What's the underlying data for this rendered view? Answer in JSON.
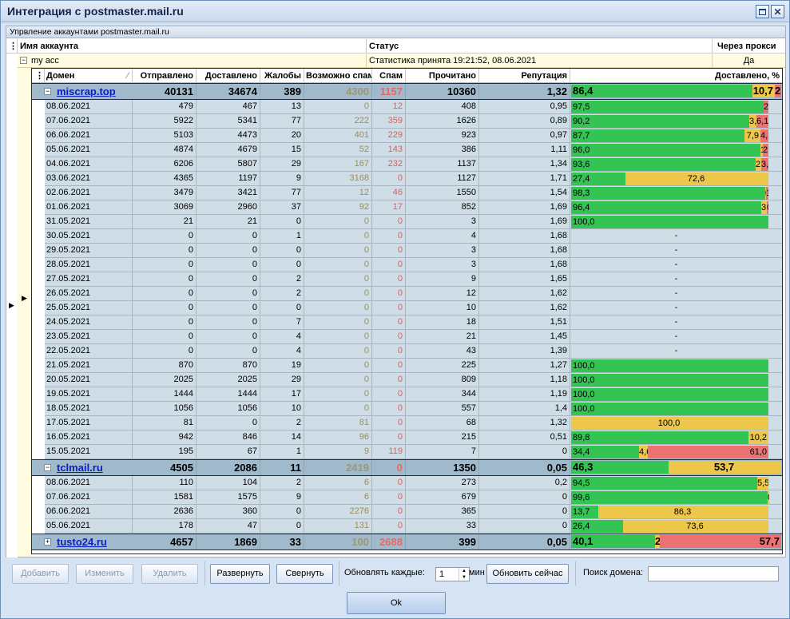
{
  "window": {
    "title": "Интеграция с postmaster.mail.ru"
  },
  "colors": {
    "green": "#33c454",
    "yellow": "#ecc74a",
    "red": "#ec7272",
    "link": "#0a1fbf",
    "group_bg": "#a1bacb",
    "row_bg": "#cfdde6"
  },
  "group_caption": "Упрвление аккаунтами postmaster.mail.ru",
  "accounts_header": {
    "name": "Имя аккаунта",
    "status": "Статус",
    "proxy": "Через прокси"
  },
  "account": {
    "name": "my acc",
    "status": "Статистика принята 19:21:52, 08.06.2021",
    "proxy": "Да"
  },
  "columns": {
    "domain": "Домен",
    "sent": "Отправлено",
    "delivered": "Доставлено",
    "complaints": "Жалобы",
    "possible_spam": "Возможно спам",
    "spam": "Спам",
    "read": "Прочитано",
    "reputation": "Репутация",
    "delivered_pct": "Доставлено, %"
  },
  "domains": [
    {
      "name": "miscrap.top",
      "expand": "−",
      "sent": "40131",
      "delivered": "34674",
      "complaints": "389",
      "possible_spam": "4300",
      "spam": "1157",
      "read": "10360",
      "reputation": "1,32",
      "bar": [
        {
          "v": 86.4,
          "t": "86,4",
          "c": "g"
        },
        {
          "v": 10.7,
          "t": "10,7",
          "c": "y"
        },
        {
          "v": 2.9,
          "t": "2,9",
          "c": "r"
        }
      ],
      "rows": [
        {
          "date": "08.06.2021",
          "sent": "479",
          "delivered": "467",
          "complaints": "13",
          "possible_spam": "0",
          "spam": "12",
          "read": "408",
          "reputation": "0,95",
          "bar": [
            {
              "v": 97.5,
              "t": "97,5",
              "c": "g"
            },
            {
              "v": 0,
              "t": "",
              "c": "y"
            },
            {
              "v": 2.5,
              "t": "2,5",
              "c": "r"
            }
          ]
        },
        {
          "date": "07.06.2021",
          "sent": "5922",
          "delivered": "5341",
          "complaints": "77",
          "possible_spam": "222",
          "spam": "359",
          "read": "1626",
          "reputation": "0,89",
          "bar": [
            {
              "v": 90.2,
              "t": "90,2",
              "c": "g"
            },
            {
              "v": 3.7,
              "t": "3,7",
              "c": "y"
            },
            {
              "v": 6.1,
              "t": "6,1",
              "c": "r"
            }
          ]
        },
        {
          "date": "06.06.2021",
          "sent": "5103",
          "delivered": "4473",
          "complaints": "20",
          "possible_spam": "401",
          "spam": "229",
          "read": "923",
          "reputation": "0,97",
          "bar": [
            {
              "v": 87.7,
              "t": "87,7",
              "c": "g"
            },
            {
              "v": 7.9,
              "t": "7,9",
              "c": "y"
            },
            {
              "v": 4.5,
              "t": "4,5",
              "c": "r"
            }
          ]
        },
        {
          "date": "05.06.2021",
          "sent": "4874",
          "delivered": "4679",
          "complaints": "15",
          "possible_spam": "52",
          "spam": "143",
          "read": "386",
          "reputation": "1,11",
          "bar": [
            {
              "v": 96.0,
              "t": "96,0",
              "c": "g"
            },
            {
              "v": 1.1,
              "t": "1,1",
              "c": "y"
            },
            {
              "v": 2.9,
              "t": "2,9",
              "c": "r"
            }
          ]
        },
        {
          "date": "04.06.2021",
          "sent": "6206",
          "delivered": "5807",
          "complaints": "29",
          "possible_spam": "167",
          "spam": "232",
          "read": "1137",
          "reputation": "1,34",
          "bar": [
            {
              "v": 93.6,
              "t": "93,6",
              "c": "g"
            },
            {
              "v": 2.7,
              "t": "2,7",
              "c": "y"
            },
            {
              "v": 3.7,
              "t": "3,7",
              "c": "r"
            }
          ]
        },
        {
          "date": "03.06.2021",
          "sent": "4365",
          "delivered": "1197",
          "complaints": "9",
          "possible_spam": "3168",
          "spam": "0",
          "read": "1127",
          "reputation": "1,71",
          "bar": [
            {
              "v": 27.4,
              "t": "27,4",
              "c": "g"
            },
            {
              "v": 72.6,
              "t": "72,6",
              "c": "y"
            },
            {
              "v": 0,
              "t": "",
              "c": "r"
            }
          ]
        },
        {
          "date": "02.06.2021",
          "sent": "3479",
          "delivered": "3421",
          "complaints": "77",
          "possible_spam": "12",
          "spam": "46",
          "read": "1550",
          "reputation": "1,54",
          "bar": [
            {
              "v": 98.3,
              "t": "98,3",
              "c": "g"
            },
            {
              "v": 0.3,
              "t": "0,3",
              "c": "y"
            },
            {
              "v": 1.3,
              "t": "1,3",
              "c": "r"
            }
          ]
        },
        {
          "date": "01.06.2021",
          "sent": "3069",
          "delivered": "2960",
          "complaints": "37",
          "possible_spam": "92",
          "spam": "17",
          "read": "852",
          "reputation": "1,69",
          "bar": [
            {
              "v": 96.4,
              "t": "96,4",
              "c": "g"
            },
            {
              "v": 3.0,
              "t": "3,0",
              "c": "y"
            },
            {
              "v": 0.6,
              "t": "0,6",
              "c": "r"
            }
          ]
        },
        {
          "date": "31.05.2021",
          "sent": "21",
          "delivered": "21",
          "complaints": "0",
          "possible_spam": "0",
          "spam": "0",
          "read": "3",
          "reputation": "1,69",
          "bar": [
            {
              "v": 100,
              "t": "100,0",
              "c": "g"
            }
          ]
        },
        {
          "date": "30.05.2021",
          "sent": "0",
          "delivered": "0",
          "complaints": "1",
          "possible_spam": "0",
          "spam": "0",
          "read": "4",
          "reputation": "1,68",
          "bar": "-"
        },
        {
          "date": "29.05.2021",
          "sent": "0",
          "delivered": "0",
          "complaints": "0",
          "possible_spam": "0",
          "spam": "0",
          "read": "3",
          "reputation": "1,68",
          "bar": "-"
        },
        {
          "date": "28.05.2021",
          "sent": "0",
          "delivered": "0",
          "complaints": "0",
          "possible_spam": "0",
          "spam": "0",
          "read": "3",
          "reputation": "1,68",
          "bar": "-"
        },
        {
          "date": "27.05.2021",
          "sent": "0",
          "delivered": "0",
          "complaints": "2",
          "possible_spam": "0",
          "spam": "0",
          "read": "9",
          "reputation": "1,65",
          "bar": "-"
        },
        {
          "date": "26.05.2021",
          "sent": "0",
          "delivered": "0",
          "complaints": "2",
          "possible_spam": "0",
          "spam": "0",
          "read": "12",
          "reputation": "1,62",
          "bar": "-"
        },
        {
          "date": "25.05.2021",
          "sent": "0",
          "delivered": "0",
          "complaints": "0",
          "possible_spam": "0",
          "spam": "0",
          "read": "10",
          "reputation": "1,62",
          "bar": "-"
        },
        {
          "date": "24.05.2021",
          "sent": "0",
          "delivered": "0",
          "complaints": "7",
          "possible_spam": "0",
          "spam": "0",
          "read": "18",
          "reputation": "1,51",
          "bar": "-"
        },
        {
          "date": "23.05.2021",
          "sent": "0",
          "delivered": "0",
          "complaints": "4",
          "possible_spam": "0",
          "spam": "0",
          "read": "21",
          "reputation": "1,45",
          "bar": "-"
        },
        {
          "date": "22.05.2021",
          "sent": "0",
          "delivered": "0",
          "complaints": "4",
          "possible_spam": "0",
          "spam": "0",
          "read": "43",
          "reputation": "1,39",
          "bar": "-"
        },
        {
          "date": "21.05.2021",
          "sent": "870",
          "delivered": "870",
          "complaints": "19",
          "possible_spam": "0",
          "spam": "0",
          "read": "225",
          "reputation": "1,27",
          "bar": [
            {
              "v": 100,
              "t": "100,0",
              "c": "g"
            }
          ]
        },
        {
          "date": "20.05.2021",
          "sent": "2025",
          "delivered": "2025",
          "complaints": "29",
          "possible_spam": "0",
          "spam": "0",
          "read": "809",
          "reputation": "1,18",
          "bar": [
            {
              "v": 100,
              "t": "100,0",
              "c": "g"
            }
          ]
        },
        {
          "date": "19.05.2021",
          "sent": "1444",
          "delivered": "1444",
          "complaints": "17",
          "possible_spam": "0",
          "spam": "0",
          "read": "344",
          "reputation": "1,19",
          "bar": [
            {
              "v": 100,
              "t": "100,0",
              "c": "g"
            }
          ]
        },
        {
          "date": "18.05.2021",
          "sent": "1056",
          "delivered": "1056",
          "complaints": "10",
          "possible_spam": "0",
          "spam": "0",
          "read": "557",
          "reputation": "1,4",
          "bar": [
            {
              "v": 100,
              "t": "100,0",
              "c": "g"
            }
          ]
        },
        {
          "date": "17.05.2021",
          "sent": "81",
          "delivered": "0",
          "complaints": "2",
          "possible_spam": "81",
          "spam": "0",
          "read": "68",
          "reputation": "1,32",
          "bar": [
            {
              "v": 0,
              "t": "",
              "c": "g"
            },
            {
              "v": 100,
              "t": "100,0",
              "c": "y"
            }
          ]
        },
        {
          "date": "16.05.2021",
          "sent": "942",
          "delivered": "846",
          "complaints": "14",
          "possible_spam": "96",
          "spam": "0",
          "read": "215",
          "reputation": "0,51",
          "bar": [
            {
              "v": 89.8,
              "t": "89,8",
              "c": "g"
            },
            {
              "v": 10.2,
              "t": "10,2",
              "c": "y"
            }
          ]
        },
        {
          "date": "15.05.2021",
          "sent": "195",
          "delivered": "67",
          "complaints": "1",
          "possible_spam": "9",
          "spam": "119",
          "read": "7",
          "reputation": "0",
          "bar": [
            {
              "v": 34.4,
              "t": "34,4",
              "c": "g"
            },
            {
              "v": 4.6,
              "t": "4,6",
              "c": "y"
            },
            {
              "v": 61.0,
              "t": "61,0",
              "c": "r"
            }
          ]
        }
      ]
    },
    {
      "name": "tclmail.ru",
      "expand": "−",
      "sent": "4505",
      "delivered": "2086",
      "complaints": "11",
      "possible_spam": "2419",
      "spam": "0",
      "read": "1350",
      "reputation": "0,05",
      "bar": [
        {
          "v": 46.3,
          "t": "46,3",
          "c": "g"
        },
        {
          "v": 53.7,
          "t": "53,7",
          "c": "y"
        }
      ],
      "rows": [
        {
          "date": "08.06.2021",
          "sent": "110",
          "delivered": "104",
          "complaints": "2",
          "possible_spam": "6",
          "spam": "0",
          "read": "273",
          "reputation": "0,2",
          "bar": [
            {
              "v": 94.5,
              "t": "94,5",
              "c": "g"
            },
            {
              "v": 5.5,
              "t": "5,5",
              "c": "y"
            }
          ]
        },
        {
          "date": "07.06.2021",
          "sent": "1581",
          "delivered": "1575",
          "complaints": "9",
          "possible_spam": "6",
          "spam": "0",
          "read": "679",
          "reputation": "0",
          "bar": [
            {
              "v": 99.6,
              "t": "99,6",
              "c": "g"
            },
            {
              "v": 0.4,
              "t": "0,4",
              "c": "y"
            }
          ]
        },
        {
          "date": "06.06.2021",
          "sent": "2636",
          "delivered": "360",
          "complaints": "0",
          "possible_spam": "2276",
          "spam": "0",
          "read": "365",
          "reputation": "0",
          "bar": [
            {
              "v": 13.7,
              "t": "13,7",
              "c": "g"
            },
            {
              "v": 86.3,
              "t": "86,3",
              "c": "y"
            }
          ]
        },
        {
          "date": "05.06.2021",
          "sent": "178",
          "delivered": "47",
          "complaints": "0",
          "possible_spam": "131",
          "spam": "0",
          "read": "33",
          "reputation": "0",
          "bar": [
            {
              "v": 26.4,
              "t": "26,4",
              "c": "g"
            },
            {
              "v": 73.6,
              "t": "73,6",
              "c": "y"
            }
          ]
        }
      ]
    },
    {
      "name": "tusto24.ru",
      "expand": "+",
      "sent": "4657",
      "delivered": "1869",
      "complaints": "33",
      "possible_spam": "100",
      "spam": "2688",
      "read": "399",
      "reputation": "0,05",
      "bar": [
        {
          "v": 40.1,
          "t": "40,1",
          "c": "g"
        },
        {
          "v": 2.1,
          "t": "2,1",
          "c": "y"
        },
        {
          "v": 57.7,
          "t": "57,7",
          "c": "r"
        }
      ],
      "rows": []
    }
  ],
  "toolbar": {
    "add": "Добавить",
    "edit": "Изменить",
    "delete": "Удалить",
    "expand": "Развернуть",
    "collapse": "Свернуть",
    "refresh_label": "Обновлять каждые:",
    "refresh_value": "1",
    "refresh_unit": "мин",
    "refresh_now": "Обновить сейчас",
    "search_label": "Поиск домена:",
    "search_value": ""
  },
  "ok": "Ok"
}
